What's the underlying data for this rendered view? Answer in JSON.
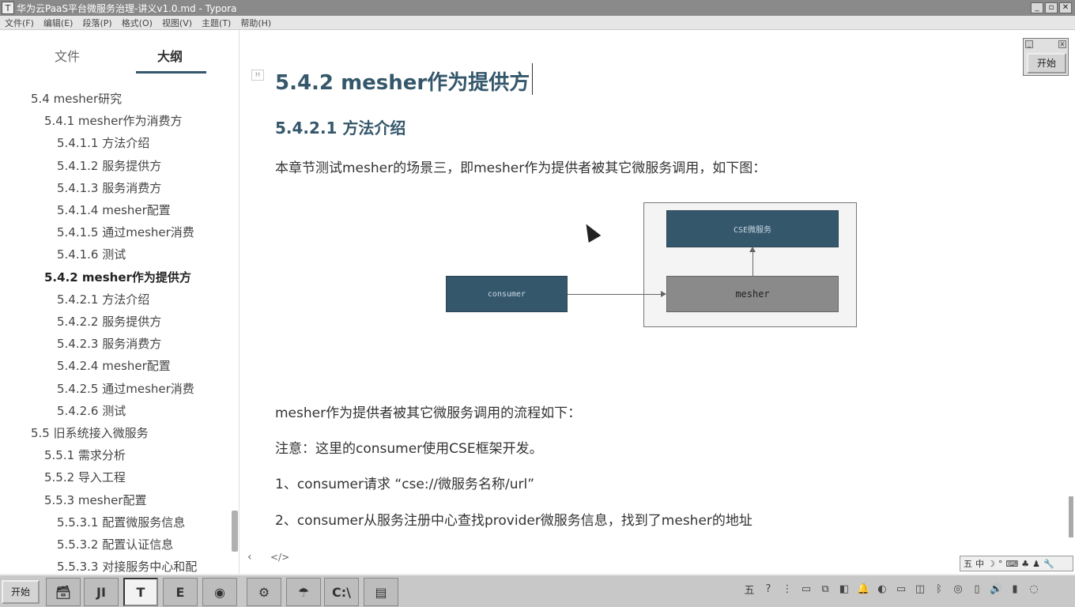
{
  "window": {
    "title": "华为云PaaS平台微服务治理-讲义v1.0.md - Typora",
    "controls": [
      "_",
      "▫",
      "✕"
    ]
  },
  "menu": [
    "文件(F)",
    "编辑(E)",
    "段落(P)",
    "格式(O)",
    "视图(V)",
    "主题(T)",
    "帮助(H)"
  ],
  "sidebar": {
    "tab_files": "文件",
    "tab_outline": "大纲",
    "items": [
      {
        "label": "5.4 mesher研究",
        "level": 1,
        "active": false
      },
      {
        "label": "5.4.1 mesher作为消费方",
        "level": 2,
        "active": false
      },
      {
        "label": "5.4.1.1 方法介绍",
        "level": 3,
        "active": false
      },
      {
        "label": "5.4.1.2 服务提供方",
        "level": 3,
        "active": false
      },
      {
        "label": "5.4.1.3 服务消费方",
        "level": 3,
        "active": false
      },
      {
        "label": "5.4.1.4 mesher配置",
        "level": 3,
        "active": false
      },
      {
        "label": "5.4.1.5 通过mesher消费",
        "level": 3,
        "active": false
      },
      {
        "label": "5.4.1.6 测试",
        "level": 3,
        "active": false
      },
      {
        "label": "5.4.2 mesher作为提供方",
        "level": 2,
        "active": true
      },
      {
        "label": "5.4.2.1 方法介绍",
        "level": 3,
        "active": false
      },
      {
        "label": "5.4.2.2 服务提供方",
        "level": 3,
        "active": false
      },
      {
        "label": "5.4.2.3 服务消费方",
        "level": 3,
        "active": false
      },
      {
        "label": "5.4.2.4 mesher配置",
        "level": 3,
        "active": false
      },
      {
        "label": "5.4.2.5 通过mesher消费",
        "level": 3,
        "active": false
      },
      {
        "label": "5.4.2.6 测试",
        "level": 3,
        "active": false
      },
      {
        "label": "5.5 旧系统接入微服务",
        "level": 1,
        "active": false
      },
      {
        "label": "5.5.1 需求分析",
        "level": 2,
        "active": false
      },
      {
        "label": "5.5.2 导入工程",
        "level": 2,
        "active": false
      },
      {
        "label": "5.5.3 mesher配置",
        "level": 2,
        "active": false
      },
      {
        "label": "5.5.3.1 配置微服务信息",
        "level": 3,
        "active": false
      },
      {
        "label": "5.5.3.2 配置认证信息",
        "level": 3,
        "active": false
      },
      {
        "label": "5.5.3.3 对接服务中心和配",
        "level": 3,
        "active": false
      }
    ]
  },
  "document": {
    "heading": "5.4.2 mesher作为提供方",
    "subheading": "5.4.2.1 方法介绍",
    "intro": "本章节测试mesher的场景三，即mesher作为提供者被其它微服务调用，如下图：",
    "diagram": {
      "cse_label": "CSE微服务",
      "consumer_label": "consumer",
      "mesher_label": "mesher"
    },
    "flow_title": "mesher作为提供者被其它微服务调用的流程如下：",
    "note": "注意：这里的consumer使用CSE框架开发。",
    "step1": "1、consumer请求 “cse://微服务名称/url”",
    "step2": "2、consumer从服务注册中心查找provider微服务信息，找到了mesher的地址"
  },
  "floating": {
    "start_label": "开始"
  },
  "editor_footer": {
    "back": "‹",
    "source": "</>"
  },
  "ime": [
    "五",
    "中",
    "☽",
    "°",
    "⌨",
    "♣",
    "♟",
    "🔧"
  ],
  "taskbar": {
    "start": "开始",
    "apps": [
      "🗃",
      "JI",
      "T",
      "E",
      "◉",
      "⚙",
      "☂",
      "C:\\",
      "▤"
    ],
    "tray": [
      "五",
      "?",
      "⋮",
      "▭",
      "⧉",
      "◧",
      "🔔",
      "◐",
      "▭",
      "◫",
      "ᛒ",
      "◎",
      "▯",
      "🔊",
      "▮",
      "◌"
    ]
  }
}
